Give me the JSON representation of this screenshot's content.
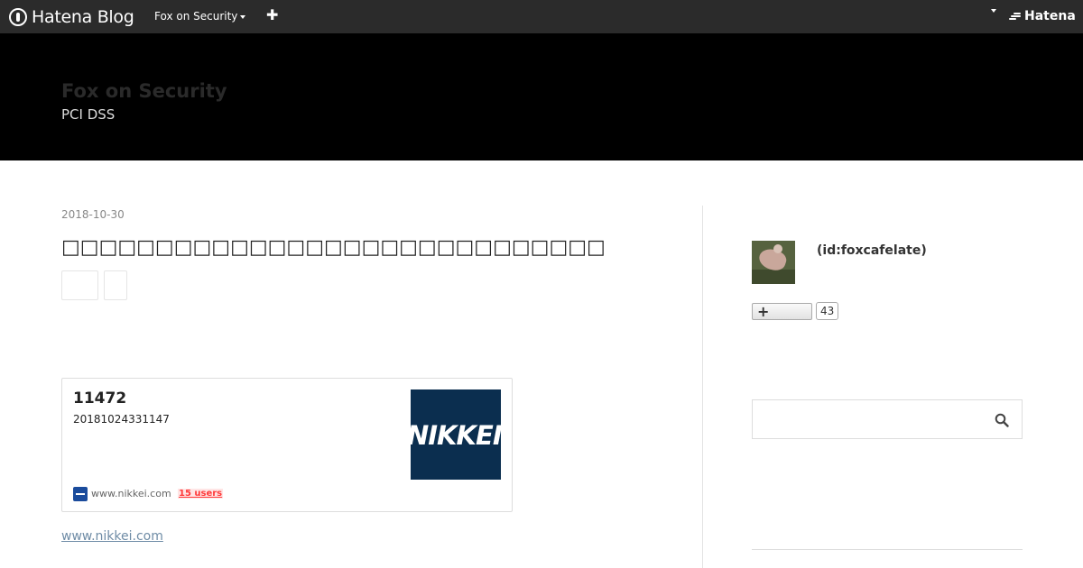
{
  "global_bar": {
    "logo_text": "Hatena Blog",
    "blog_name": "Fox on Security",
    "add_icon": "plus-icon",
    "brand_text": "Hatena"
  },
  "blog": {
    "title": "Fox on Security",
    "description": "PCI DSS"
  },
  "entry": {
    "date": "2018-10-30",
    "title": "□□□□□□□□□□□□□□□□□□□□□□□□□□□□□",
    "embed_card": {
      "title": "11472",
      "description": "20181024331147",
      "thumbnail_text": "NIKKEI",
      "site": "www.nikkei.com",
      "bookmark_users": "15 users"
    },
    "link_text": "www.nikkei.com"
  },
  "sidebar": {
    "profile_id": "(id:foxcafelate)",
    "follow_count": "43",
    "search_placeholder": ""
  },
  "colors": {
    "global_bar": "#2b2b2b",
    "header_bg": "#000000",
    "link": "#6f8ca6",
    "bookmark_red": "#ff3a3a",
    "nikkei_blue": "#0b2e4f"
  }
}
